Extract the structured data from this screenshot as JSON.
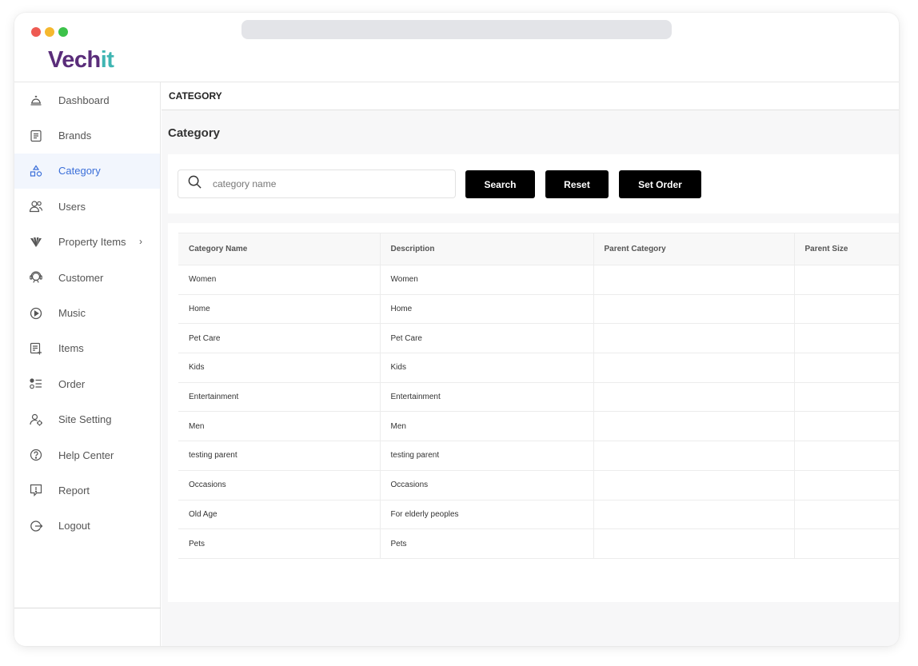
{
  "brand": {
    "part1": "Vech",
    "part2": "it",
    "color1": "#5a2d7a",
    "color2": "#3fb5b2"
  },
  "window_dots": [
    "#ee5a52",
    "#f5b82e",
    "#3cc24a"
  ],
  "sidebar": {
    "active_color": "#3b6fd9",
    "items": [
      {
        "label": "Dashboard",
        "icon": "dashboard-bell-icon"
      },
      {
        "label": "Brands",
        "icon": "brands-list-icon"
      },
      {
        "label": "Category",
        "icon": "category-shapes-icon",
        "active": true
      },
      {
        "label": "Users",
        "icon": "users-icon"
      },
      {
        "label": "Property Items",
        "icon": "property-items-icon",
        "has_submenu": true
      },
      {
        "label": "Customer",
        "icon": "customer-support-icon"
      },
      {
        "label": "Music",
        "icon": "music-play-icon"
      },
      {
        "label": "Items",
        "icon": "items-add-icon"
      },
      {
        "label": "Order",
        "icon": "order-list-icon"
      },
      {
        "label": "Site Setting",
        "icon": "site-setting-user-icon"
      },
      {
        "label": "Help Center",
        "icon": "help-question-icon"
      },
      {
        "label": "Report",
        "icon": "report-alert-icon"
      },
      {
        "label": "Logout",
        "icon": "logout-icon"
      }
    ]
  },
  "header": {
    "breadcrumb": "CATEGORY"
  },
  "page": {
    "title": "Category"
  },
  "filters": {
    "search_placeholder": "category name",
    "search_value": "",
    "search_button": "Search",
    "reset_button": "Reset",
    "set_order_button": "Set Order"
  },
  "table": {
    "columns": [
      "Category Name",
      "Description",
      "Parent Category",
      "Parent Size"
    ],
    "rows": [
      [
        "Women",
        "Women",
        "",
        ""
      ],
      [
        "Home",
        "Home",
        "",
        ""
      ],
      [
        "Pet Care",
        "Pet Care",
        "",
        ""
      ],
      [
        "Kids",
        "Kids",
        "",
        ""
      ],
      [
        "Entertainment",
        "Entertainment",
        "",
        ""
      ],
      [
        "Men",
        "Men",
        "",
        ""
      ],
      [
        "testing parent",
        "testing parent",
        "",
        ""
      ],
      [
        "Occasions",
        "Occasions",
        "",
        ""
      ],
      [
        "Old Age",
        "For elderly peoples",
        "",
        ""
      ],
      [
        "Pets",
        "Pets",
        "",
        ""
      ]
    ]
  }
}
